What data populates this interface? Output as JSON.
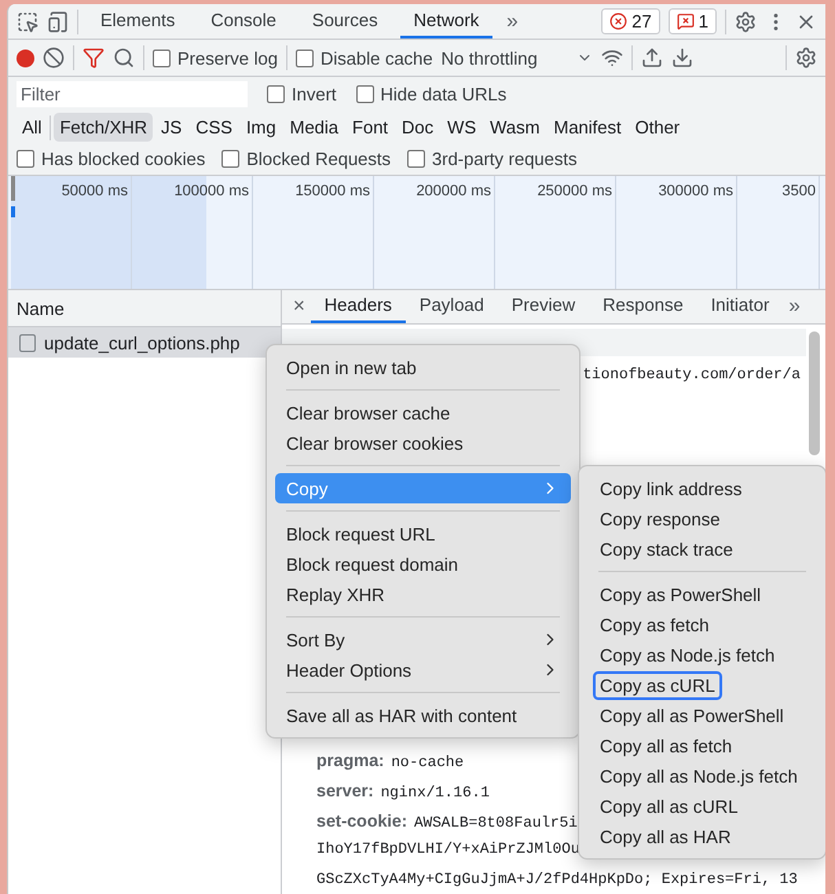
{
  "tabs": [
    {
      "label": "Elements",
      "selected": false
    },
    {
      "label": "Console",
      "selected": false
    },
    {
      "label": "Sources",
      "selected": false
    },
    {
      "label": "Network",
      "selected": true
    }
  ],
  "more_tabs": "»",
  "badges": {
    "errors": "27",
    "warnings": "1"
  },
  "toolbar": {
    "recording": true,
    "preserve_log": {
      "label": "Preserve log",
      "checked": false
    },
    "disable_cache": {
      "label": "Disable cache",
      "checked": false
    },
    "throttling": "No throttling"
  },
  "filter": {
    "placeholder": "Filter",
    "invert": {
      "label": "Invert",
      "checked": false
    },
    "hide_data_urls": {
      "label": "Hide data URLs",
      "checked": false
    }
  },
  "types": [
    {
      "label": "All",
      "selected": false
    },
    {
      "label": "Fetch/XHR",
      "selected": true
    },
    {
      "label": "JS",
      "selected": false
    },
    {
      "label": "CSS",
      "selected": false
    },
    {
      "label": "Img",
      "selected": false
    },
    {
      "label": "Media",
      "selected": false
    },
    {
      "label": "Font",
      "selected": false
    },
    {
      "label": "Doc",
      "selected": false
    },
    {
      "label": "WS",
      "selected": false
    },
    {
      "label": "Wasm",
      "selected": false
    },
    {
      "label": "Manifest",
      "selected": false
    },
    {
      "label": "Other",
      "selected": false
    }
  ],
  "extra_filters": [
    {
      "label": "Has blocked cookies",
      "checked": false
    },
    {
      "label": "Blocked Requests",
      "checked": false
    },
    {
      "label": "3rd-party requests",
      "checked": false
    }
  ],
  "timeline": {
    "ticks": [
      "50000 ms",
      "100000 ms",
      "150000 ms",
      "200000 ms",
      "250000 ms",
      "300000 ms",
      "3500"
    ]
  },
  "requests": {
    "column": "Name",
    "rows": [
      {
        "name": "update_curl_options.php",
        "selected": true
      }
    ]
  },
  "detail_tabs": [
    {
      "label": "Headers",
      "selected": true
    },
    {
      "label": "Payload",
      "selected": false
    },
    {
      "label": "Preview",
      "selected": false
    },
    {
      "label": "Response",
      "selected": false
    },
    {
      "label": "Initiator",
      "selected": false
    }
  ],
  "detail_close": "×",
  "detail_more": "»",
  "general_url_fragment": "tionofbeauty.com/order/a",
  "headers": [
    {
      "key": "pragma:",
      "value": "no-cache"
    },
    {
      "key": "server:",
      "value": "nginx/1.16.1"
    },
    {
      "key": "set-cookie:",
      "value": "AWSALB=8t08Faulr5i"
    },
    {
      "value": "IhoY17fBpDVLHI/Y+xAiPrZJMl0Ou"
    },
    {
      "value": "GScZXcTyA4My+CIgGuJjmA+J/2fPd4HpKpDo; Expires=Fri, 13"
    }
  ],
  "context_menu": [
    [
      {
        "label": "Open in new tab",
        "selected": false,
        "submenu": false
      }
    ],
    [
      {
        "label": "Clear browser cache",
        "selected": false,
        "submenu": false
      },
      {
        "label": "Clear browser cookies",
        "selected": false,
        "submenu": false
      }
    ],
    [
      {
        "label": "Copy",
        "selected": true,
        "submenu": true
      }
    ],
    [
      {
        "label": "Block request URL",
        "selected": false,
        "submenu": false
      },
      {
        "label": "Block request domain",
        "selected": false,
        "submenu": false
      },
      {
        "label": "Replay XHR",
        "selected": false,
        "submenu": false
      }
    ],
    [
      {
        "label": "Sort By",
        "selected": false,
        "submenu": true
      },
      {
        "label": "Header Options",
        "selected": false,
        "submenu": true
      }
    ],
    [
      {
        "label": "Save all as HAR with content",
        "selected": false,
        "submenu": false
      }
    ]
  ],
  "copy_submenu": [
    [
      {
        "label": "Copy link address",
        "focused": false
      },
      {
        "label": "Copy response",
        "focused": false
      },
      {
        "label": "Copy stack trace",
        "focused": false
      }
    ],
    [
      {
        "label": "Copy as PowerShell",
        "focused": false
      },
      {
        "label": "Copy as fetch",
        "focused": false
      },
      {
        "label": "Copy as Node.js fetch",
        "focused": false
      },
      {
        "label": "Copy as cURL",
        "focused": true
      },
      {
        "label": "Copy all as PowerShell",
        "focused": false
      },
      {
        "label": "Copy all as fetch",
        "focused": false
      },
      {
        "label": "Copy all as Node.js fetch",
        "focused": false
      },
      {
        "label": "Copy all as cURL",
        "focused": false
      },
      {
        "label": "Copy all as HAR",
        "focused": false
      }
    ]
  ]
}
